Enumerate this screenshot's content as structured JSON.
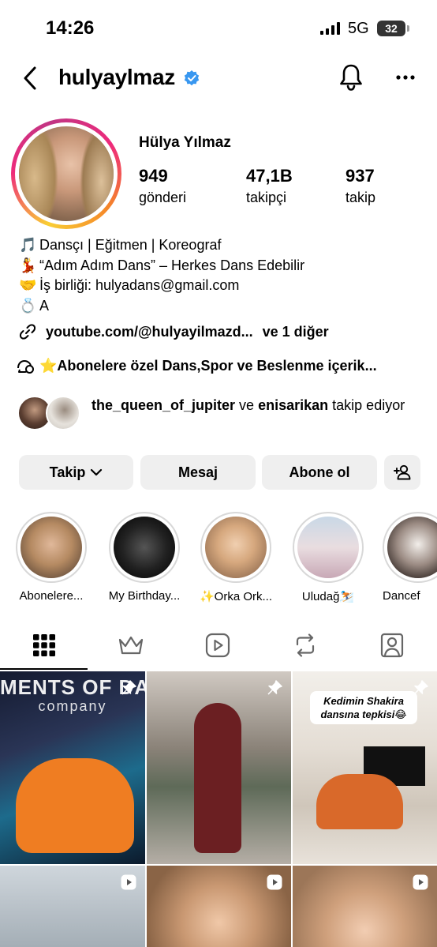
{
  "status_bar": {
    "time": "14:26",
    "network": "5G",
    "battery": "32"
  },
  "header": {
    "username": "hulyaylmaz",
    "verified": true
  },
  "profile": {
    "full_name": "Hülya Yılmaz",
    "stats": [
      {
        "value": "949",
        "label": "gönderi"
      },
      {
        "value": "47,1B",
        "label": "takipçi"
      },
      {
        "value": "937",
        "label": "takip"
      }
    ],
    "bio": [
      {
        "emoji": "🎵",
        "text": "Dansçı | Eğitmen | Koreograf"
      },
      {
        "emoji": "💃",
        "text": "“Adım Adım Dans” – Herkes Dans Edebilir"
      },
      {
        "emoji": "🤝",
        "text": "İş birliği: hulyadans@gmail.com"
      },
      {
        "emoji": "💍",
        "text": "A"
      }
    ],
    "link": {
      "url": "youtube.com/@hulyayilmazd...",
      "more": "ve 1 diğer"
    },
    "channel": {
      "text": "⭐Abonelere özel Dans,Spor ve Beslenme içerik..."
    },
    "followed_by": {
      "user1": "the_queen_of_jupiter",
      "joiner": "ve",
      "user2": "enisarikan",
      "suffix": "takip ediyor"
    }
  },
  "buttons": {
    "follow": "Takip",
    "message": "Mesaj",
    "subscribe": "Abone ol"
  },
  "highlights": [
    {
      "label": "Abonelere..."
    },
    {
      "label": "My Birthday..."
    },
    {
      "label": "✨Orka Ork..."
    },
    {
      "label": "Uludağ⛷️"
    },
    {
      "label": "Dancef"
    }
  ],
  "tabs": [
    "grid-icon",
    "crown-icon",
    "reels-icon",
    "reposts-icon",
    "tagged-icon"
  ],
  "posts": [
    {
      "banner": "MENTS OF DAN",
      "banner_sub": "company"
    },
    {},
    {
      "caption": "Kedimin Shakira dansına tepkisi😂"
    },
    {},
    {},
    {}
  ]
}
